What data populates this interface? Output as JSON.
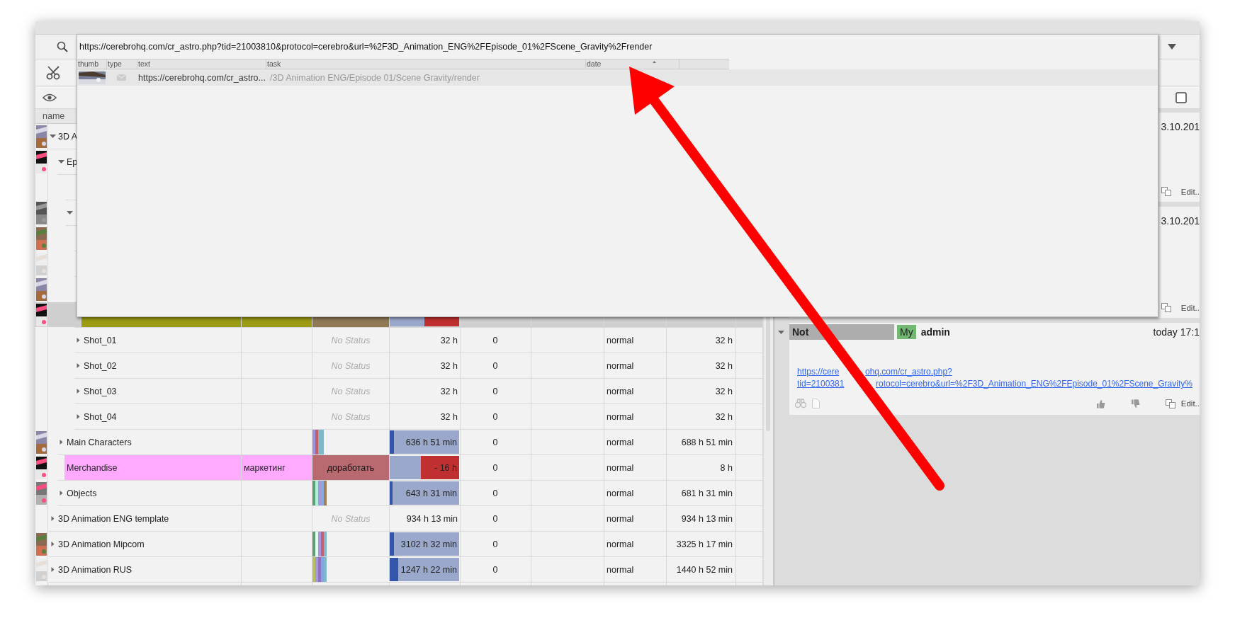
{
  "search": {
    "value": "https://cerebrohq.com/cr_astro.php?tid=21003810&protocol=cerebro&url=%2F3D_Animation_ENG%2FEpisode_01%2FScene_Gravity%2Frender"
  },
  "results": {
    "columns": [
      "thumb",
      "type",
      "text",
      "task",
      "date"
    ],
    "rows": [
      {
        "text": "https://cerebrohq.com/cr_astro...",
        "task": "/3D Animation ENG/Episode 01/Scene Gravity/render"
      }
    ]
  },
  "table": {
    "columns": [
      "name"
    ],
    "rows": [
      {
        "name": "3D A",
        "thumb": true,
        "expanded": true,
        "children": [
          {
            "name": "Ep",
            "thumb": true,
            "expanded": true,
            "children": [
              {
                "thumb": false
              },
              {
                "thumb": true,
                "expanded": true,
                "children": [
                  {
                    "thumb": true
                  },
                  {
                    "thumb": true
                  },
                  {
                    "thumb": true
                  },
                  {
                    "thumb": true,
                    "selected": true,
                    "color": "#9b9b14",
                    "status": {
                      "kind": "label",
                      "color": "#8f7a55"
                    },
                    "overrun": {
                      "level": 0.5
                    }
                  },
                  {
                    "name": "Shot_01",
                    "thumb": false,
                    "expanded": false,
                    "status": {
                      "kind": "none",
                      "text": "No Status"
                    },
                    "time": "32 h",
                    "count": "0",
                    "priority": "normal",
                    "total": "32 h"
                  },
                  {
                    "name": "Shot_02",
                    "thumb": false,
                    "expanded": false,
                    "status": {
                      "kind": "none",
                      "text": "No Status"
                    },
                    "time": "32 h",
                    "count": "0",
                    "priority": "normal",
                    "total": "32 h"
                  },
                  {
                    "name": "Shot_03",
                    "thumb": false,
                    "expanded": false,
                    "status": {
                      "kind": "none",
                      "text": "No Status"
                    },
                    "time": "32 h",
                    "count": "0",
                    "priority": "normal",
                    "total": "32 h"
                  },
                  {
                    "name": "Shot_04",
                    "thumb": false,
                    "expanded": false,
                    "status": {
                      "kind": "none",
                      "text": "No Status"
                    },
                    "time": "32 h",
                    "count": "0",
                    "priority": "normal",
                    "total": "32 h"
                  }
                ]
              }
            ]
          },
          {
            "name": "Main Characters",
            "thumb": true,
            "expanded": false,
            "status": {
              "kind": "mix",
              "segments": [
                {
                  "color": "#a090e0"
                },
                {
                  "color": "#c06060"
                },
                {
                  "color": "#80b8c8"
                },
                {
                  "color": "#80b8c8"
                }
              ]
            },
            "bar": {
              "level": 0.06
            },
            "time": "636 h 51 min",
            "count": "0",
            "priority": "normal",
            "total": "688 h 51 min"
          },
          {
            "name": "Merchandise",
            "thumb": true,
            "color": "#ffaaff",
            "tag": "маркетинг",
            "status": {
              "kind": "label",
              "text": "доработать",
              "color": "#b96a70"
            },
            "overrun": {
              "level": 0.55
            },
            "time": "- 16 h",
            "count": "0",
            "priority": "normal",
            "total": "8 h"
          },
          {
            "name": "Objects",
            "thumb": true,
            "expanded": false,
            "status": {
              "kind": "mix",
              "segments": [
                {
                  "color": "#5aa070"
                },
                {
                  "color": "#b0f0e0"
                },
                {
                  "color": "#a898e0"
                },
                {
                  "color": "#88aadd"
                },
                {
                  "color": "#a08050"
                }
              ]
            },
            "bar": {
              "level": 0.04
            },
            "time": "643 h 31 min",
            "count": "0",
            "priority": "normal",
            "total": "681 h 31 min"
          }
        ]
      },
      {
        "name": "3D Animation ENG template",
        "thumb": false,
        "expanded": false,
        "status": {
          "kind": "none",
          "text": "No Status"
        },
        "time": "934 h 13 min",
        "count": "0",
        "priority": "normal",
        "total": "934 h 13 min"
      },
      {
        "name": "3D Animation Mipcom",
        "thumb": true,
        "expanded": false,
        "status": {
          "kind": "mix",
          "segments": [
            {
              "color": "#5aa070"
            },
            {
              "color": "#e8f8f0"
            },
            {
              "color": "#a898e0"
            },
            {
              "color": "#c06070"
            },
            {
              "color": "#80b8c8"
            }
          ]
        },
        "bar": {
          "level": 0.06
        },
        "time": "3102 h 32 min",
        "count": "0",
        "priority": "normal",
        "total": "3325 h 17 min"
      },
      {
        "name": "3D Animation RUS",
        "thumb": true,
        "expanded": false,
        "status": {
          "kind": "mix",
          "segments": [
            {
              "color": "#b8c060"
            },
            {
              "color": "#a898e0"
            },
            {
              "color": "#9070c0"
            },
            {
              "color": "#80a8e0"
            },
            {
              "color": "#80b8c8"
            }
          ]
        },
        "bar": {
          "level": 0.12
        },
        "time": "1247 h 22 min",
        "count": "0",
        "priority": "normal",
        "total": "1440 h 52 min"
      }
    ]
  },
  "messages": [
    {
      "kind": "card",
      "date": "3.10.201",
      "edit": "Edit.."
    },
    {
      "kind": "card",
      "date": "3.10.201",
      "edit": "Edit.."
    },
    {
      "kind": "note",
      "title": "Not",
      "badge": "My",
      "author": "admin",
      "time": "today 17:1",
      "link_lines": [
        [
          "https://cere",
          "ohq.com/cr_astro.php?"
        ],
        [
          "tid=2100381",
          "rotocol=cerebro&url=%2F3D_Animation_ENG%2FEpisode_01%2FScene_Gravity%"
        ]
      ],
      "edit": "Edit.."
    }
  ]
}
